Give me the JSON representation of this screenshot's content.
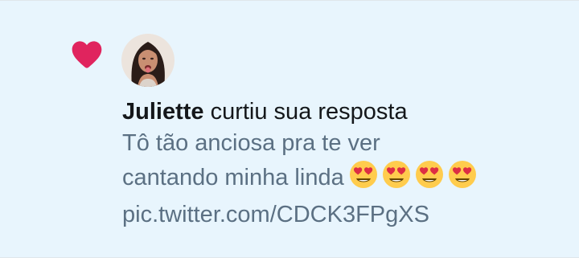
{
  "notification": {
    "icon": "heart-icon",
    "accent_color": "#e0245e",
    "avatar": "user-avatar-juliette",
    "username": "Juliette",
    "action_text": " curtiu sua resposta",
    "tweet_lines": [
      "Tô tão anciosa pra te ver",
      "cantando minha linda"
    ],
    "emojis": [
      "heart-eyes-emoji",
      "heart-eyes-emoji",
      "heart-eyes-emoji",
      "heart-eyes-emoji"
    ],
    "link": "pic.twitter.com/CDCK3FPgXS"
  }
}
